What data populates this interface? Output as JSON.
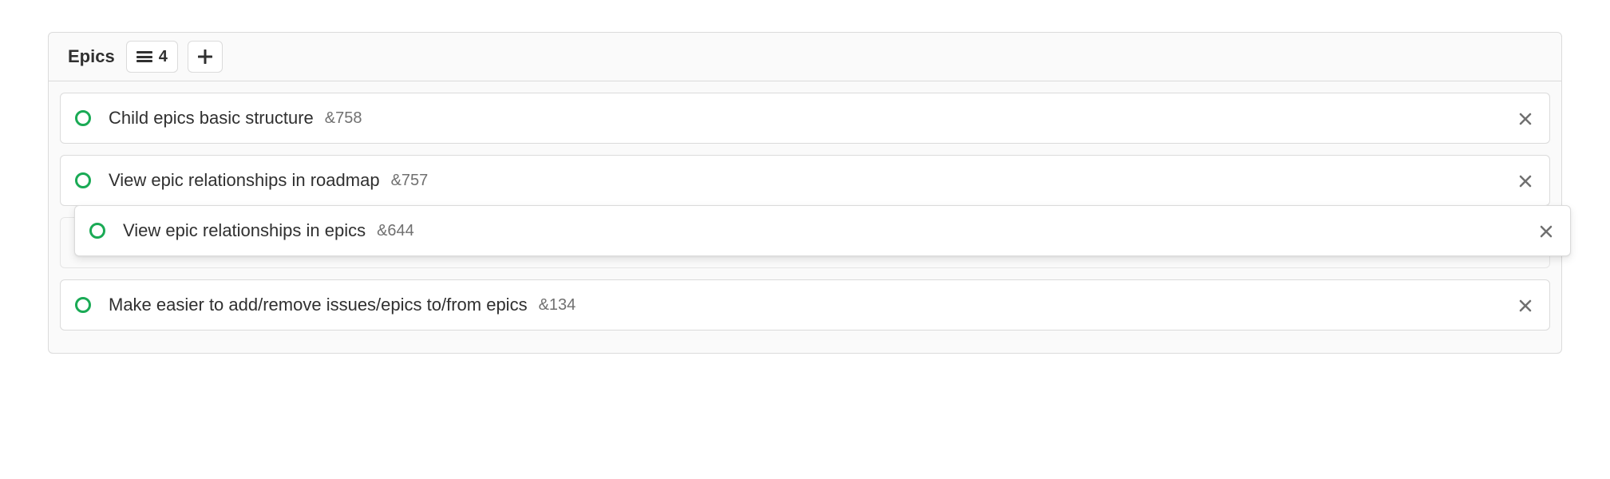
{
  "header": {
    "title": "Epics",
    "count": "4"
  },
  "epics": [
    {
      "title": "Child epics basic structure",
      "id": "&758"
    },
    {
      "title": "View epic relationships in roadmap",
      "id": "&757"
    },
    {
      "title": "View epic relationships in epics",
      "id": "&644"
    },
    {
      "title": "Make easier to add/remove issues/epics to/from epics",
      "id": "&134"
    }
  ],
  "dragging": {
    "title": "View epic relationships in epics",
    "id": "&644"
  }
}
